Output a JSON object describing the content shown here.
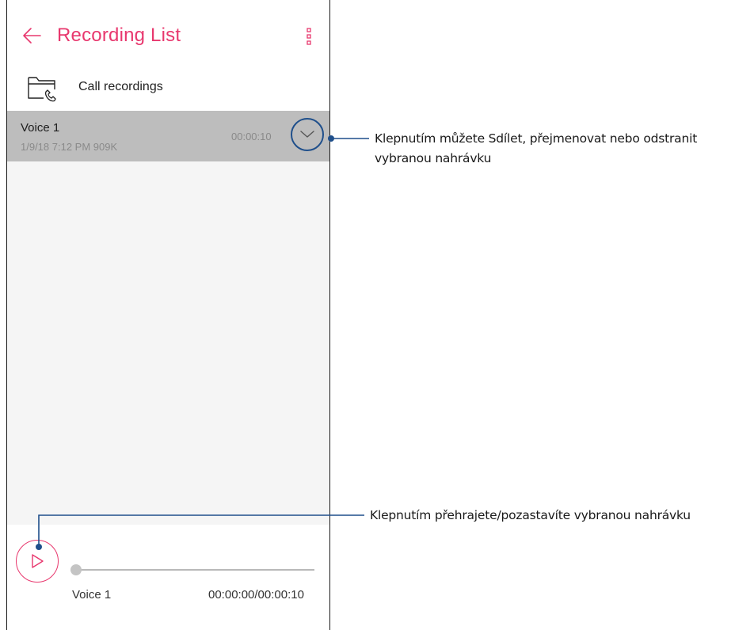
{
  "app": {
    "title": "Recording List",
    "colors": {
      "accent": "#e8386e",
      "selected_row": "#bdbdbd",
      "list_background": "#f5f5f5",
      "callout": "#1f4f8b"
    }
  },
  "appbar": {
    "back_icon": "arrow-left-icon",
    "more_icon": "more-vertical-icon"
  },
  "folder": {
    "icon": "folder-phone-icon",
    "label": "Call recordings"
  },
  "recordings": [
    {
      "name": "Voice 1",
      "meta": "1/9/18 7:12 PM   909K",
      "duration": "00:00:10",
      "selected": true
    }
  ],
  "player": {
    "play_icon": "play-icon",
    "title": "Voice 1",
    "time": "00:00:00/00:00:10",
    "progress": 0
  },
  "callouts": {
    "expand": "Klepnutím můžete Sdílet, přejmenovat nebo odstranit vybranou nahrávku",
    "play": "Klepnutím přehrajete/pozastavíte vybranou nahrávku"
  }
}
